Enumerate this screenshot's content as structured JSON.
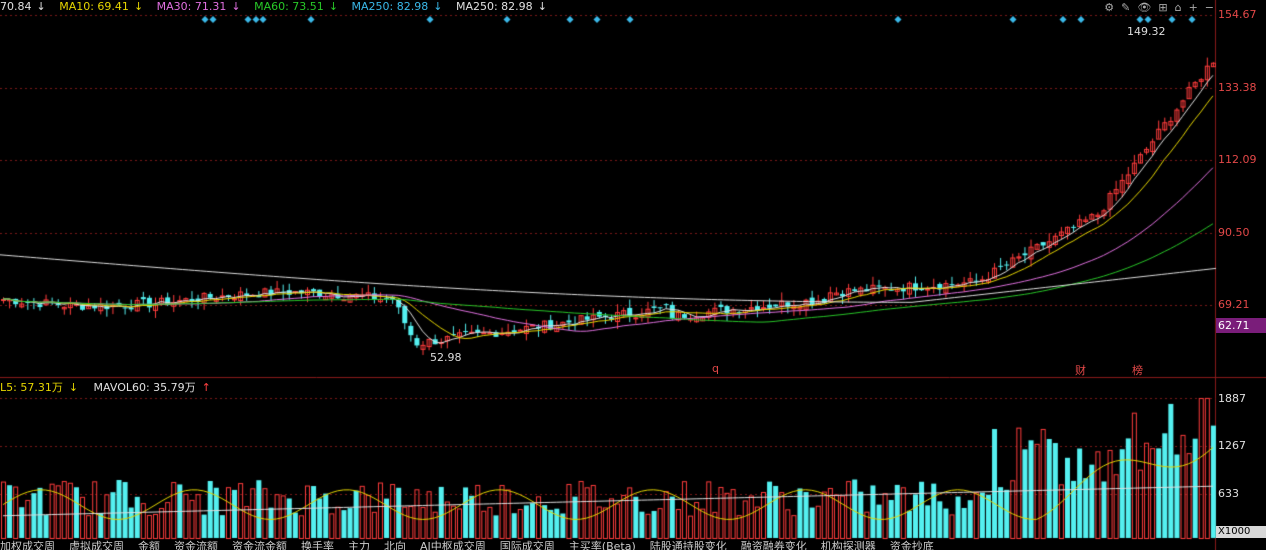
{
  "ma_legend": [
    {
      "label": "70.84",
      "arrow": "↓",
      "color": "#e0e0e0"
    },
    {
      "label": "MA10: 69.41",
      "arrow": "↓",
      "color": "#e6d600"
    },
    {
      "label": "MA30: 71.31",
      "arrow": "↓",
      "color": "#e070e0"
    },
    {
      "label": "MA60: 73.51",
      "arrow": "↓",
      "color": "#28c828"
    },
    {
      "label": "MA250: 82.98",
      "arrow": "↓",
      "color": "#3ab8e8"
    },
    {
      "label": "MA250: 82.98",
      "arrow": "↓",
      "color": "#e0e0e0"
    }
  ],
  "vol_legend": [
    {
      "label": "L5: 57.31万",
      "arrow": "↓",
      "color": "#e6d600"
    },
    {
      "label": "MAVOL60: 35.79万",
      "arrow": "↑",
      "color": "#e0e0e0"
    }
  ],
  "toolbar_icons": [
    "⚙",
    "✎",
    "👁",
    "⊞",
    "⌂",
    "+",
    "−"
  ],
  "price_axis": [
    "154.67",
    "133.38",
    "112.09",
    "90.50",
    "69.21"
  ],
  "vol_axis": [
    "1887",
    "1267",
    "633"
  ],
  "current_price": "62.71",
  "vol_unit": "X1000",
  "annotations": {
    "high": "149.32",
    "low": "52.98"
  },
  "event_markers": [
    "q",
    "财",
    "榜"
  ],
  "bottom_tabs": [
    "加权成交周",
    "虚拟成交周",
    "金额",
    "资金流额",
    "资金流金额",
    "换手率",
    "主力",
    "北向",
    "AI中枢成交周",
    "国际成交周",
    "主买率(Beta)",
    "陆股通持股变化",
    "融资融券变化",
    "机构探测器",
    "资金抄底"
  ],
  "colors": {
    "up": "#ff3c3c",
    "down": "#54f0f0",
    "grid": "#7a1818",
    "ma5": "#e0e0e0",
    "ma10": "#e6d600",
    "ma30": "#e070e0",
    "ma60": "#28c828",
    "ma250": "#e0e0e0",
    "diamond": "#3ab8e8"
  }
}
